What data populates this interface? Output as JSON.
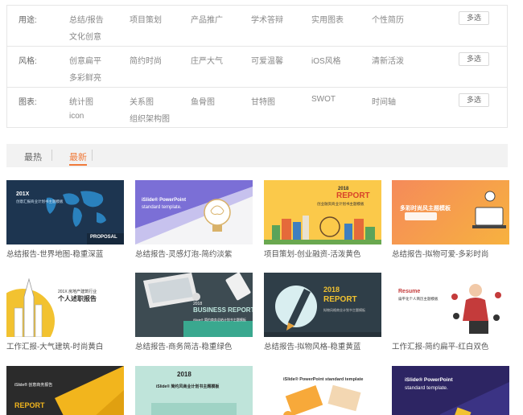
{
  "filters": [
    {
      "label": "用途:",
      "options_line1": [
        "总结/报告",
        "项目策划",
        "产品推广",
        "学术答辩",
        "实用图表",
        "个性简历"
      ],
      "options_line2": [
        "文化创意"
      ],
      "multi": "多选"
    },
    {
      "label": "风格:",
      "options_line1": [
        "创意扁平",
        "简约时尚",
        "庄严大气",
        "可爱温馨",
        "iOS风格",
        "清新活泼"
      ],
      "options_line2": [
        "多彩鲜亮"
      ],
      "multi": "多选"
    },
    {
      "label": "图表:",
      "options_line1": [
        "统计图",
        "关系图",
        "鱼骨图",
        "甘特图",
        "SWOT",
        "时间轴"
      ],
      "options_line2": [
        "icon",
        "组织架构图"
      ],
      "multi": "多选"
    }
  ],
  "sort": {
    "hot": "最热",
    "new": "最新"
  },
  "cards": [
    {
      "caption": "总结报告-世界地图-稳重深蓝",
      "thumb": {
        "title": "201X",
        "sub": "创意汇报商业计划书主题模板",
        "tag": "PROPOSAL"
      }
    },
    {
      "caption": "总结报告-灵感灯泡-简约淡紫",
      "thumb": {
        "title": "iSlide® PowerPoint",
        "sub": "standard template."
      }
    },
    {
      "caption": "项目策划-创业融资-活泼黄色",
      "thumb": {
        "title": "2018",
        "big": "REPORT",
        "sub": "创业融资商业计划书主题模板"
      }
    },
    {
      "caption": "总结报告-拟物可爱-多彩时尚",
      "thumb": {
        "title": "多彩时尚风主题模板"
      }
    },
    {
      "caption": "工作汇报-大气建筑-时尚黄白",
      "thumb": {
        "title": "201X 房地产建筑行业",
        "big": "个人述职报告"
      }
    },
    {
      "caption": "总结报告-商务简洁-稳重绿色",
      "thumb": {
        "title": "2018",
        "big": "BUSINESS REPORT",
        "sub": "iSlide® 简约商务总结计划书主题模板"
      }
    },
    {
      "caption": "总结报告-拟物风格-稳重黄蓝",
      "thumb": {
        "title": "2018",
        "big": "REPORT",
        "sub": "拟物风格商业计划书主题模板"
      }
    },
    {
      "caption": "工作汇报-简约扁平-红白双色",
      "thumb": {
        "title": "Resume",
        "sub": "扁平化个人简历主题模板"
      }
    },
    {
      "caption": "",
      "thumb": {
        "title": "iSlide® 创意商务报告",
        "big": "REPORT"
      }
    },
    {
      "caption": "",
      "thumb": {
        "title": "2018",
        "sub": "iSlide® 简约风商业计划书主题模板"
      }
    },
    {
      "caption": "",
      "thumb": {
        "title": "iSlide® PowerPoint standard template"
      }
    },
    {
      "caption": "",
      "thumb": {
        "title": "iSlide® PowerPoint",
        "sub": "standard template."
      }
    }
  ]
}
